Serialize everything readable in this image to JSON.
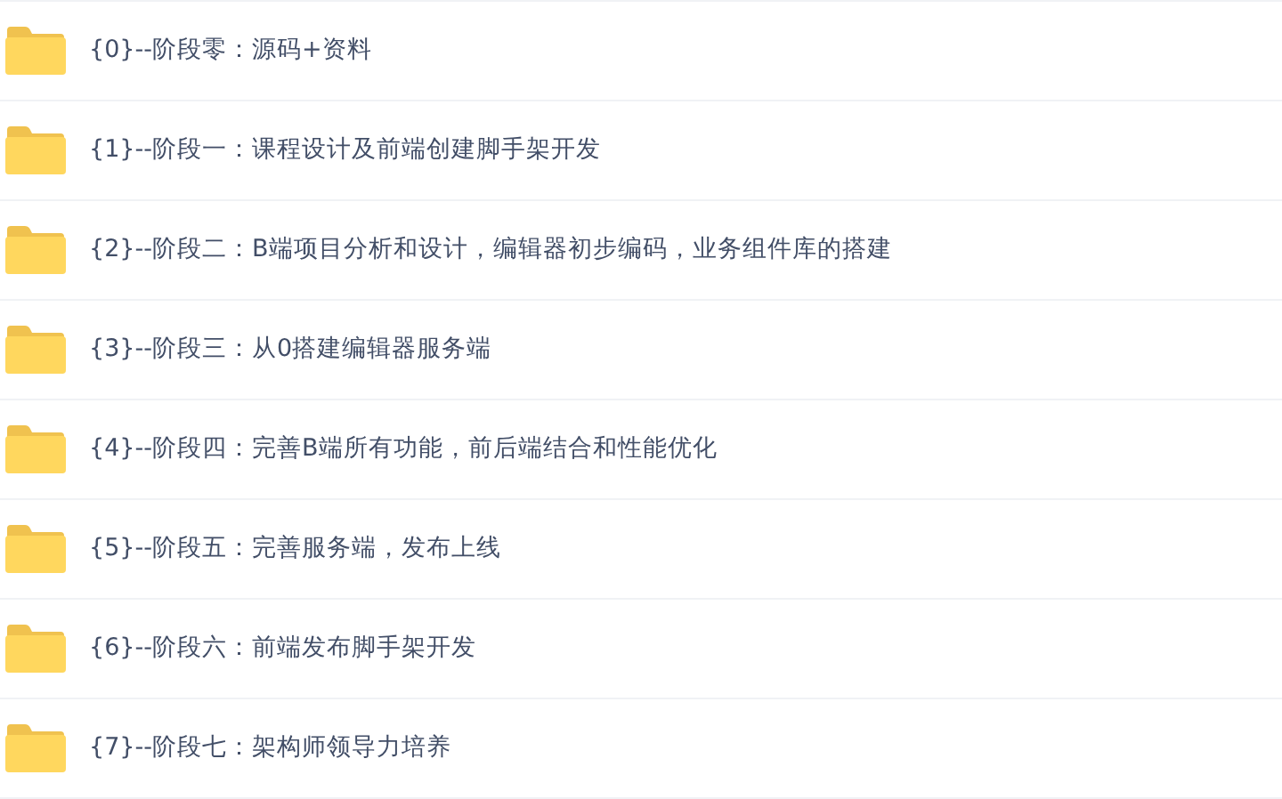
{
  "folders": [
    {
      "name": "{0}--阶段零：源码+资料"
    },
    {
      "name": "{1}--阶段一：课程设计及前端创建脚手架开发"
    },
    {
      "name": "{2}--阶段二：B端项目分析和设计，编辑器初步编码，业务组件库的搭建"
    },
    {
      "name": "{3}--阶段三：从0搭建编辑器服务端"
    },
    {
      "name": "{4}--阶段四：完善B端所有功能，前后端结合和性能优化"
    },
    {
      "name": "{5}--阶段五：完善服务端，发布上线"
    },
    {
      "name": "{6}--阶段六：前端发布脚手架开发"
    },
    {
      "name": "{7}--阶段七：架构师领导力培养"
    }
  ]
}
